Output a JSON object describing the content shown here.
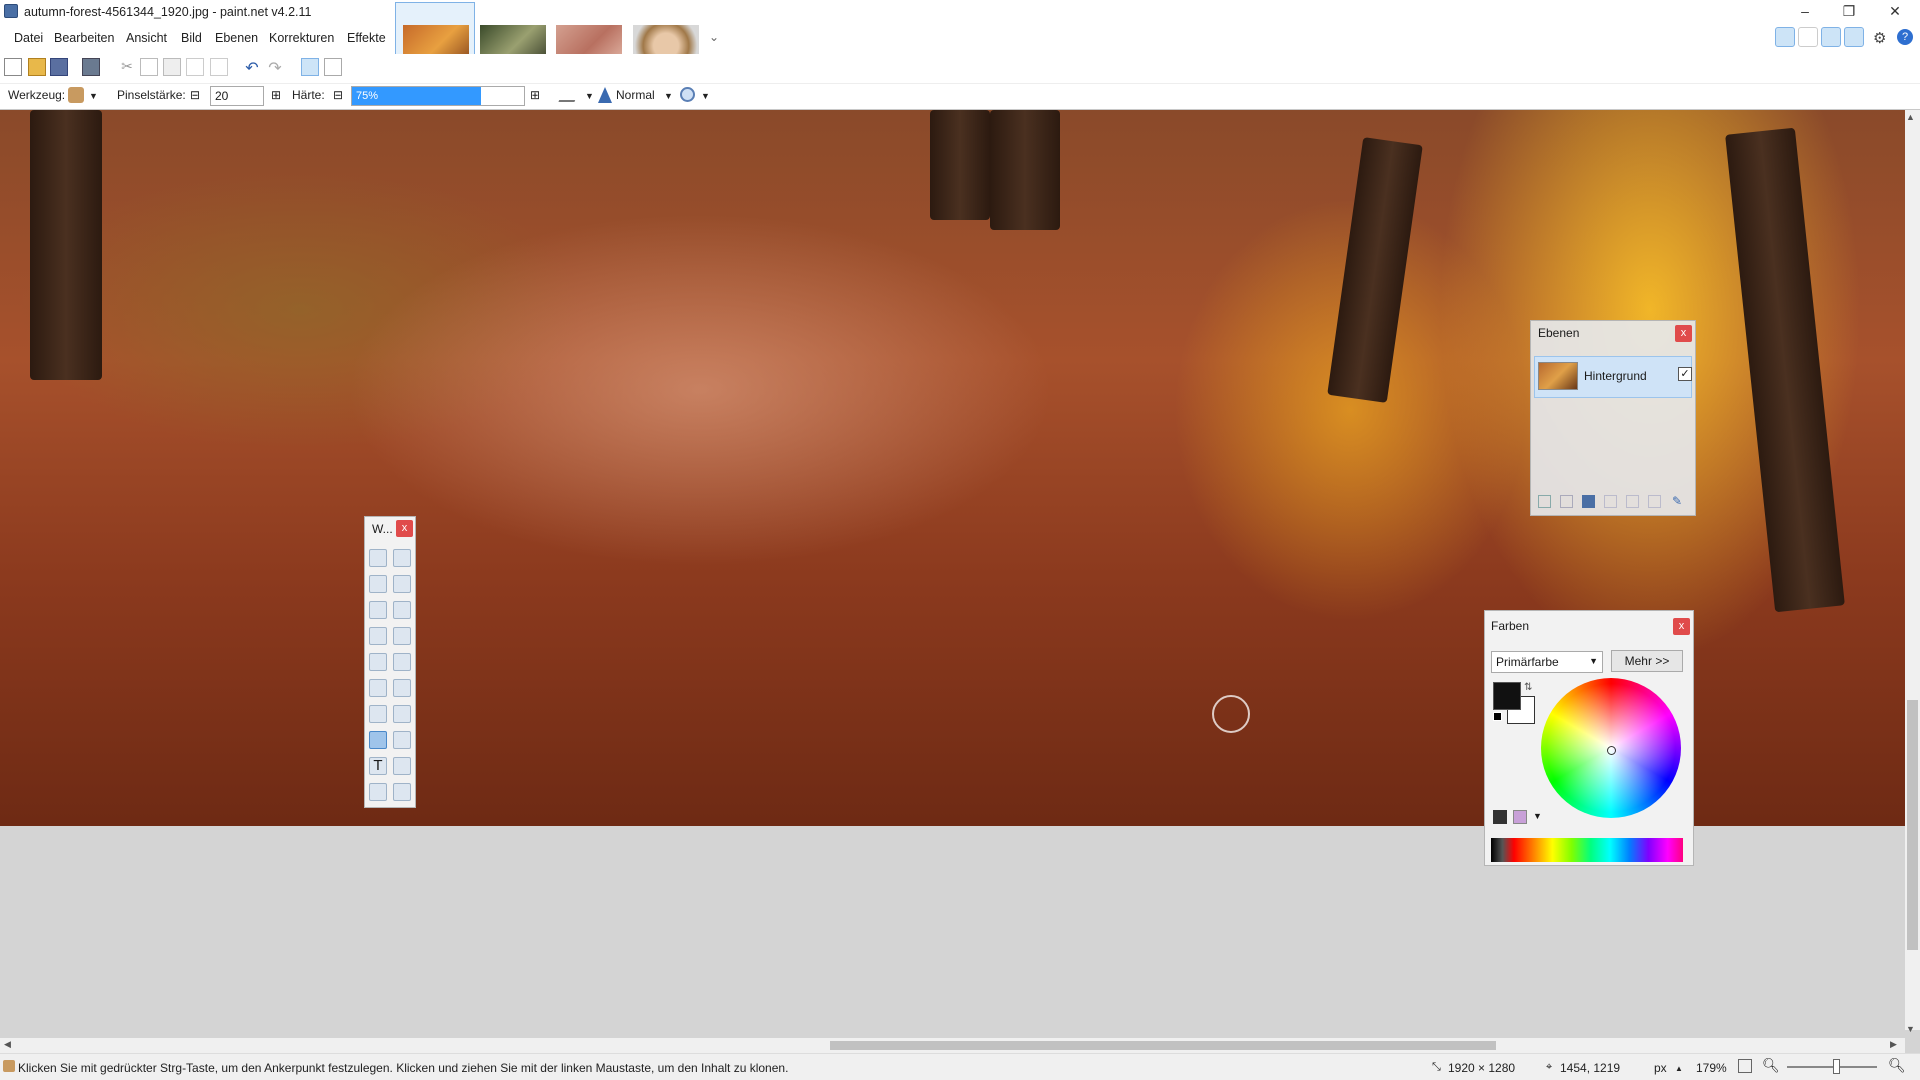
{
  "window": {
    "title": "autumn-forest-4561344_1920.jpg - paint.net v4.2.11",
    "minimize": "–",
    "restore": "❐",
    "close": "✕"
  },
  "menu": [
    "Datei",
    "Bearbeiten",
    "Ansicht",
    "Bild",
    "Ebenen",
    "Korrekturen",
    "Effekte"
  ],
  "thumbnail_more": "⌄",
  "toolbar": {
    "tool_label": "Werkzeug:",
    "brush_size_label": "Pinselstärke:",
    "brush_size_value": "20",
    "hardness_label": "Härte:",
    "hardness_value": "75%",
    "hardness_fraction": 0.75,
    "blend_mode": "Normal",
    "minus": "⊟",
    "plus": "⊞"
  },
  "tools_window": {
    "title": "W...",
    "close": "x"
  },
  "layers_window": {
    "title": "Ebenen",
    "close": "x",
    "layers": [
      {
        "name": "Hintergrund",
        "visible_check": "✓"
      }
    ]
  },
  "colors_window": {
    "title": "Farben",
    "close": "x",
    "primary_select": "Primärfarbe",
    "more_button": "Mehr >>",
    "primary_color": "#111111",
    "secondary_color": "#ffffff"
  },
  "status": {
    "hint": "Klicken Sie mit gedrückter Strg-Taste, um den Ankerpunkt festzulegen. Klicken und ziehen Sie mit der linken Maustaste, um den Inhalt zu klonen.",
    "image_size": "1920 × 1280",
    "cursor_pos": "1454, 1219",
    "units": "px",
    "zoom": "179%"
  },
  "colors": {
    "accent": "#3399ff",
    "selection": "#cfe3f7"
  }
}
